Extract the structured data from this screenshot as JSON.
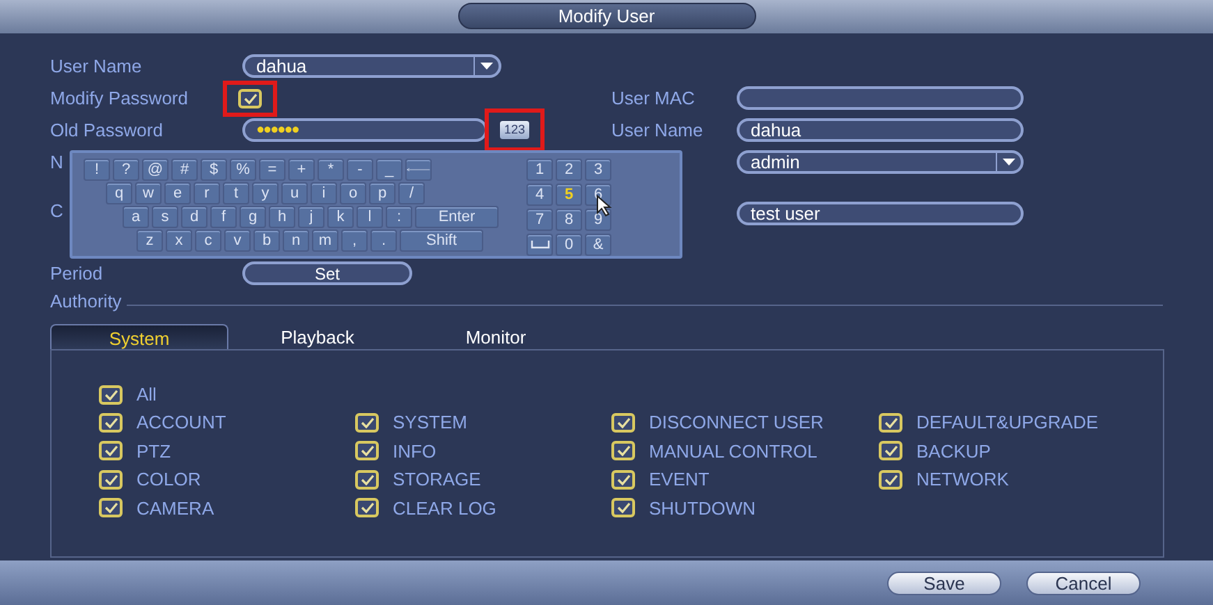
{
  "window": {
    "title": "Modify User"
  },
  "form": {
    "user_name": {
      "label": "User Name",
      "value": "dahua"
    },
    "modify_password": {
      "label": "Modify Password",
      "checked": true,
      "highlighted": true
    },
    "old_password": {
      "label": "Old Password",
      "value": "●●●●●●",
      "keyboard_button": "123",
      "keyboard_button_highlighted": true
    },
    "new_password": {
      "label": "N"
    },
    "confirm_password": {
      "label": "C"
    },
    "period": {
      "label": "Period",
      "button": "Set"
    }
  },
  "right_form": {
    "user_mac": {
      "label": "User MAC"
    },
    "user_name": {
      "label": "User Name",
      "value": "dahua"
    },
    "group": {
      "value": "admin"
    },
    "memo": {
      "value": "test user"
    }
  },
  "keyboard": {
    "rows": [
      [
        {
          "label": "!"
        },
        {
          "label": "?"
        },
        {
          "label": "@"
        },
        {
          "label": "#"
        },
        {
          "label": "$"
        },
        {
          "label": "%"
        },
        {
          "label": "="
        },
        {
          "label": "+"
        },
        {
          "label": "*"
        },
        {
          "label": "-"
        },
        {
          "label": "_"
        },
        {
          "kind": "backspace"
        }
      ],
      [
        {
          "label": "q"
        },
        {
          "label": "w"
        },
        {
          "label": "e"
        },
        {
          "label": "r"
        },
        {
          "label": "t"
        },
        {
          "label": "y"
        },
        {
          "label": "u"
        },
        {
          "label": "i"
        },
        {
          "label": "o"
        },
        {
          "label": "p"
        },
        {
          "label": "/"
        }
      ],
      [
        {
          "label": "a"
        },
        {
          "label": "s"
        },
        {
          "label": "d"
        },
        {
          "label": "f"
        },
        {
          "label": "g"
        },
        {
          "label": "h"
        },
        {
          "label": "j"
        },
        {
          "label": "k"
        },
        {
          "label": "l"
        },
        {
          "label": ":"
        },
        {
          "label": "Enter",
          "kind": "wide"
        }
      ],
      [
        {
          "label": "z"
        },
        {
          "label": "x"
        },
        {
          "label": "c"
        },
        {
          "label": "v"
        },
        {
          "label": "b"
        },
        {
          "label": "n"
        },
        {
          "label": "m"
        },
        {
          "label": ","
        },
        {
          "label": "."
        },
        {
          "label": "Shift",
          "kind": "wide"
        }
      ]
    ],
    "numpad": [
      {
        "label": "1",
        "highlighted": false
      },
      {
        "label": "2",
        "highlighted": false
      },
      {
        "label": "3",
        "highlighted": false
      },
      {
        "label": "4",
        "highlighted": false
      },
      {
        "label": "5",
        "highlighted": true
      },
      {
        "label": "6",
        "highlighted": false
      },
      {
        "label": "7",
        "highlighted": false
      },
      {
        "label": "8",
        "highlighted": false
      },
      {
        "label": "9",
        "highlighted": false
      },
      {
        "kind": "space",
        "highlighted": false
      },
      {
        "label": "0",
        "highlighted": false
      },
      {
        "label": "&",
        "highlighted": false
      }
    ]
  },
  "authority": {
    "title": "Authority",
    "tabs": [
      {
        "label": "System",
        "selected": true
      },
      {
        "label": "Playback",
        "selected": false
      },
      {
        "label": "Monitor",
        "selected": false
      }
    ],
    "all": {
      "label": "All",
      "checked": true
    },
    "columns": [
      [
        {
          "label": "ACCOUNT",
          "checked": true
        },
        {
          "label": "PTZ",
          "checked": true
        },
        {
          "label": "COLOR",
          "checked": true
        },
        {
          "label": "CAMERA",
          "checked": true
        }
      ],
      [
        {
          "label": "SYSTEM",
          "checked": true
        },
        {
          "label": "INFO",
          "checked": true
        },
        {
          "label": "STORAGE",
          "checked": true
        },
        {
          "label": "CLEAR LOG",
          "checked": true
        }
      ],
      [
        {
          "label": "DISCONNECT USER",
          "checked": true
        },
        {
          "label": "MANUAL CONTROL",
          "checked": true
        },
        {
          "label": "EVENT",
          "checked": true
        },
        {
          "label": "SHUTDOWN",
          "checked": true
        }
      ],
      [
        {
          "label": "DEFAULT&UPGRADE",
          "checked": true
        },
        {
          "label": "BACKUP",
          "checked": true
        },
        {
          "label": "NETWORK",
          "checked": true
        }
      ]
    ]
  },
  "buttons": [
    {
      "label": "Save"
    },
    {
      "label": "Cancel"
    }
  ]
}
